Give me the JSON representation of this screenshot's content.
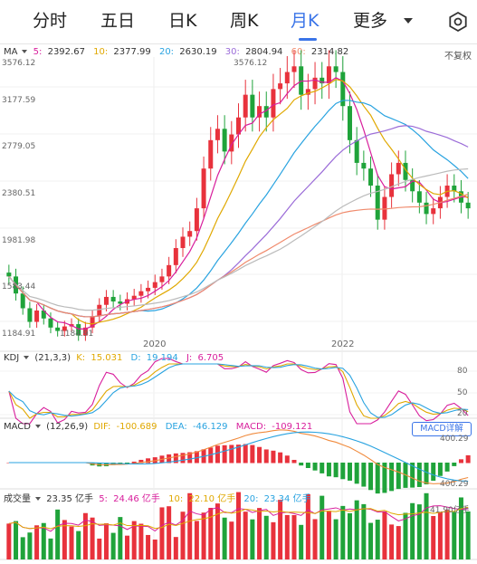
{
  "tabs": [
    "分时",
    "五日",
    "日K",
    "周K",
    "月K",
    "更多"
  ],
  "active_tab": "月K",
  "ma_legend": {
    "name": "MA",
    "items": [
      {
        "label": "5:",
        "value": "2392.67",
        "color": "#d81e9c"
      },
      {
        "label": "10:",
        "value": "2377.99",
        "color": "#e0a800"
      },
      {
        "label": "20:",
        "value": "2630.19",
        "color": "#29a3e0"
      },
      {
        "label": "30:",
        "value": "2804.94",
        "color": "#9b6cd8"
      },
      {
        "label": "60:",
        "value": "2314.82",
        "color": "#f08a6c"
      }
    ],
    "right_label": "不复权"
  },
  "price_axis": [
    "3576.12",
    "3177.59",
    "2779.05",
    "2380.51",
    "1981.98",
    "1583.44",
    "1184.91"
  ],
  "high_label": "3576.12",
  "low_label": "1184.91",
  "x_labels": [
    "2020",
    "2022"
  ],
  "kdj_legend": {
    "name": "KDJ",
    "params": "(21,3,3)",
    "items": [
      {
        "label": "K:",
        "value": "15.031",
        "color": "#e0a800"
      },
      {
        "label": "D:",
        "value": "19.194",
        "color": "#29a3e0"
      },
      {
        "label": "J:",
        "value": "6.705",
        "color": "#d81e9c"
      }
    ]
  },
  "kdj_axis": [
    "80",
    "50",
    "20"
  ],
  "macd_legend": {
    "name": "MACD",
    "params": "(12,26,9)",
    "items": [
      {
        "label": "DIF:",
        "value": "-100.689",
        "color": "#e0a800"
      },
      {
        "label": "DEA:",
        "value": "-46.129",
        "color": "#29a3e0"
      },
      {
        "label": "MACD:",
        "value": "-109.121",
        "color": "#d81e9c"
      }
    ]
  },
  "macd_button": "MACD详解",
  "macd_axis": [
    "400.29",
    "400.29"
  ],
  "vol_legend": {
    "name": "成交量",
    "value": "23.35 亿手",
    "items": [
      {
        "label": "5:",
        "value": "24.46 亿手",
        "color": "#d81e9c"
      },
      {
        "label": "10:",
        "value": "22.10 亿手",
        "color": "#e0a800"
      },
      {
        "label": "20:",
        "value": "23.34 亿手",
        "color": "#29a3e0"
      }
    ]
  },
  "vol_axis": "41.90亿手",
  "chart_data": {
    "type": "candlestick",
    "ylim": [
      1184.91,
      3576.12
    ],
    "close": [
      1700,
      1550,
      1420,
      1300,
      1400,
      1330,
      1250,
      1220,
      1260,
      1280,
      1180,
      1250,
      1350,
      1450,
      1520,
      1480,
      1460,
      1500,
      1530,
      1570,
      1600,
      1650,
      1700,
      1800,
      1950,
      2050,
      2100,
      2300,
      2650,
      2900,
      3000,
      2800,
      2950,
      3100,
      3300,
      3100,
      3200,
      3100,
      3350,
      3400,
      3500,
      3550,
      3300,
      3350,
      3450,
      3400,
      3550,
      3500,
      3200,
      2900,
      2700,
      2650,
      2500,
      2200,
      2400,
      2600,
      2700,
      2550,
      2450,
      2350,
      2250,
      2300,
      2400,
      2500,
      2450,
      2350,
      2300
    ]
  }
}
